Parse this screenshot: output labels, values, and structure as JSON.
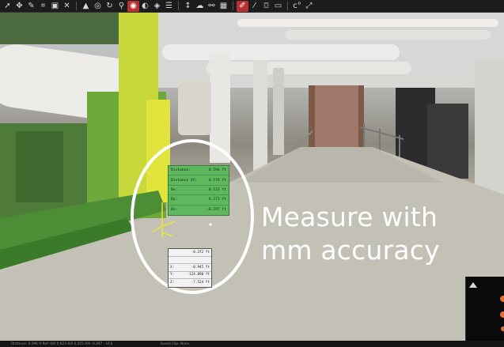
{
  "toolbar": {
    "buttons": [
      {
        "icon": "pointer-arrow-icon",
        "glyph": "➚",
        "active": false
      },
      {
        "icon": "pan-icon",
        "glyph": "✥",
        "active": false
      },
      {
        "icon": "paint-icon",
        "glyph": "✎",
        "active": false
      },
      {
        "icon": "crop-icon",
        "glyph": "⌗",
        "active": false
      },
      {
        "icon": "box-icon",
        "glyph": "▣",
        "active": false
      },
      {
        "icon": "close-x-icon",
        "glyph": "✕",
        "active": false
      },
      {
        "icon": "warning-triangle-icon",
        "glyph": "▲",
        "active": false
      },
      {
        "icon": "target-icon",
        "glyph": "◎",
        "active": false
      },
      {
        "icon": "rotate-icon",
        "glyph": "↻",
        "active": false
      },
      {
        "icon": "pin-icon",
        "glyph": "⚲",
        "active": false
      },
      {
        "icon": "measure-active-icon",
        "glyph": "◉",
        "active": true
      },
      {
        "icon": "sphere-icon",
        "glyph": "◐",
        "active": false
      },
      {
        "icon": "cube-icon",
        "glyph": "◈",
        "active": false
      },
      {
        "icon": "layers-icon",
        "glyph": "☰",
        "active": false
      },
      {
        "icon": "height-icon",
        "glyph": "↕",
        "active": false
      },
      {
        "icon": "cloud-icon",
        "glyph": "☁",
        "active": false
      },
      {
        "icon": "link-icon",
        "glyph": "⚯",
        "active": false
      },
      {
        "icon": "grid-icon",
        "glyph": "▦",
        "active": false
      },
      {
        "icon": "pen-edit-icon",
        "glyph": "✐",
        "active": true
      },
      {
        "icon": "eyedropper-icon",
        "glyph": "⁄",
        "active": false
      },
      {
        "icon": "camera-icon",
        "glyph": "⌼",
        "active": false
      },
      {
        "icon": "film-icon",
        "glyph": "▭",
        "active": false
      },
      {
        "icon": "rotate-degrees-icon",
        "glyph": "c°",
        "active": false
      },
      {
        "icon": "expand-icon",
        "glyph": "⤢",
        "active": false
      }
    ]
  },
  "measure_panel": {
    "rows": [
      {
        "label": "Distance:",
        "value": "0.596 ft"
      },
      {
        "label": "Distance XY:",
        "value": "0.576 ft"
      },
      {
        "label": "Dx:",
        "value": "0.523 ft"
      },
      {
        "label": "Dy:",
        "value": "0.271 ft"
      },
      {
        "label": "Dz:",
        "value": "-0.297 ft"
      }
    ]
  },
  "coord_panel": {
    "rows": [
      {
        "label": "",
        "value": "-0.372 ft"
      },
      {
        "label": "",
        "value": ""
      },
      {
        "label": "X:",
        "value": "-0.945 ft"
      },
      {
        "label": "Y:",
        "value": "-124.890 ft"
      },
      {
        "label": "Z:",
        "value": "-7.524 ft"
      }
    ]
  },
  "caption": {
    "line1": "Measure with",
    "line2": "mm accuracy"
  },
  "statusbar": {
    "text": "Distance: 0.596 ft   Ref: 0/0  0.623  0/0  0.025  0/0  -0.297  ·  UCS",
    "right_text": "Saved Clip: None"
  },
  "colors": {
    "measure_green": "#5fb85e",
    "highlight_circle": "#ffffff",
    "active_tool": "#b83030"
  }
}
